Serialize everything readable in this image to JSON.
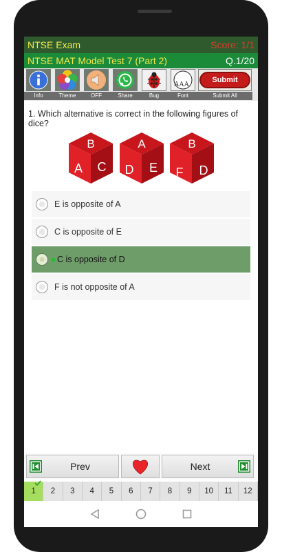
{
  "header": {
    "app_title": "NTSE Exam",
    "score": "Score: 1/1",
    "test_title": "NTSE MAT Model Test 7 (Part 2)",
    "question_counter": "Q.1/20"
  },
  "toolbar": {
    "items": [
      {
        "label": "Info",
        "icon": "info-icon"
      },
      {
        "label": "Theme",
        "icon": "theme-icon"
      },
      {
        "label": "OFF",
        "icon": "sound-off-icon"
      },
      {
        "label": "Share",
        "icon": "share-icon"
      },
      {
        "label": "Bug",
        "icon": "bug-icon"
      },
      {
        "label": "Font",
        "icon": "font-icon"
      }
    ],
    "submit_button": "Submit",
    "submit_all_label": "Submit All",
    "font_icon_text": "AAA"
  },
  "question": {
    "text": "1. Which alternative is correct in the following figures of dice?",
    "dice": [
      {
        "top": "B",
        "left": "A",
        "right": "C"
      },
      {
        "top": "A",
        "left": "D",
        "right": "E"
      },
      {
        "top": "B",
        "left": "F",
        "right": "D"
      }
    ],
    "options": [
      {
        "text": "E is opposite of A",
        "selected": false
      },
      {
        "text": "C is opposite of E",
        "selected": false
      },
      {
        "text": "C is opposite of D",
        "selected": true
      },
      {
        "text": "F is not opposite of A",
        "selected": false
      }
    ]
  },
  "navigation": {
    "prev_label": "Prev",
    "next_label": "Next"
  },
  "pager": {
    "pages": [
      "1",
      "2",
      "3",
      "4",
      "5",
      "6",
      "7",
      "8",
      "9",
      "10",
      "11",
      "12"
    ],
    "current": "1"
  },
  "colors": {
    "header_dark": "#2e5a2e",
    "header_green": "#1b8b3a",
    "title_yellow": "#f4e94a",
    "score_red": "#e23b2b",
    "dice_red": "#c8161d",
    "selected_option": "#6f9d6a",
    "current_page": "#a5dd5f"
  }
}
